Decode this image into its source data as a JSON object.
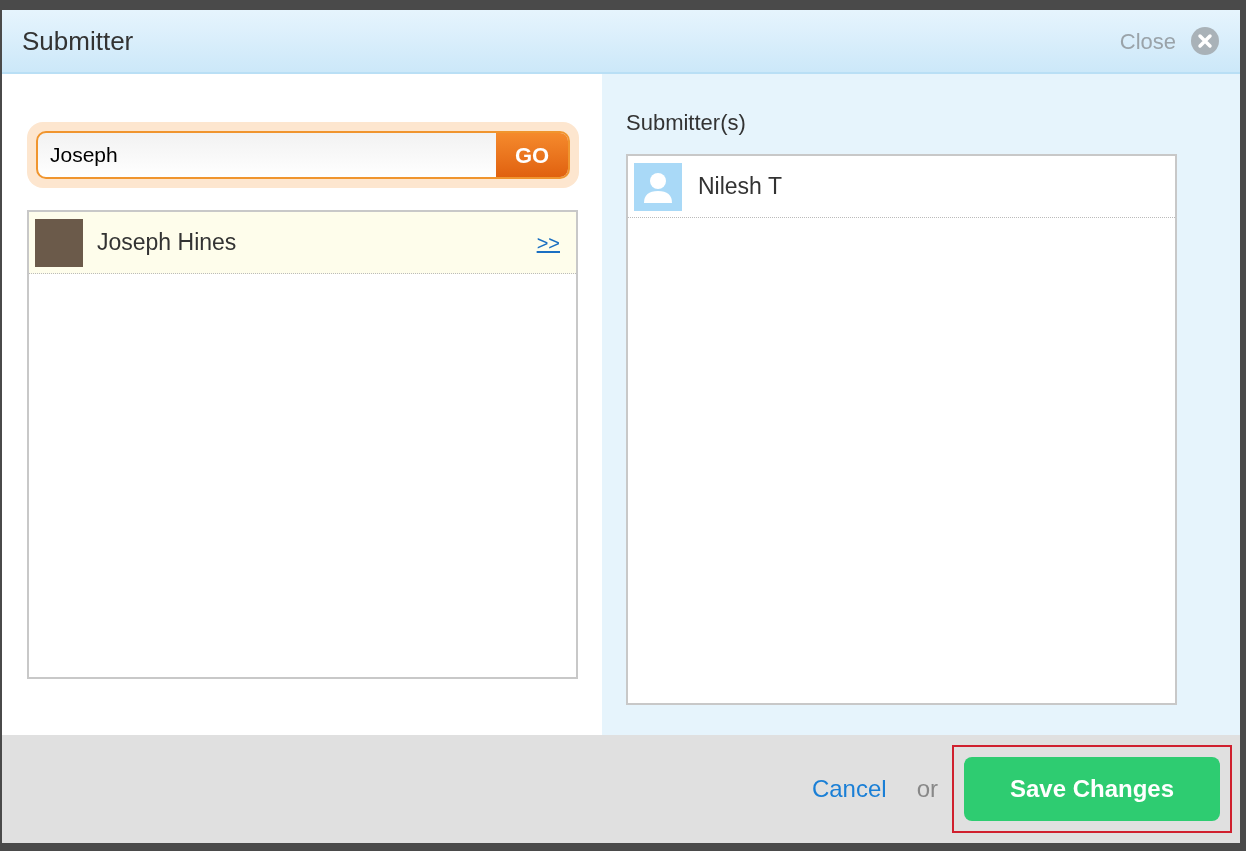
{
  "dialog": {
    "title": "Submitter",
    "close_label": "Close"
  },
  "search": {
    "value": "Joseph",
    "button": "GO"
  },
  "results": [
    {
      "name": "Joseph Hines",
      "kind": "photo",
      "action": ">>"
    }
  ],
  "selected_panel": {
    "title": "Submitter(s)",
    "items": [
      {
        "name": "Nilesh T",
        "kind": "default"
      }
    ]
  },
  "footer": {
    "cancel": "Cancel",
    "or": "or",
    "save": "Save Changes",
    "save_highlighted": true
  }
}
